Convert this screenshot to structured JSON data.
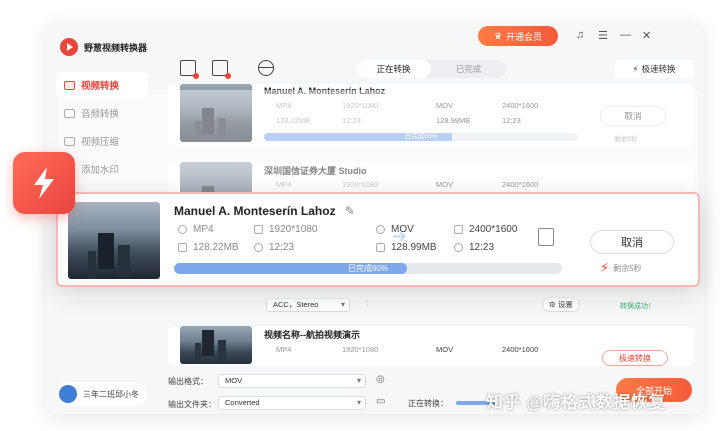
{
  "app": {
    "title": "野葱视频转换器"
  },
  "header": {
    "vip_label": "开通会员"
  },
  "sidebar": {
    "items": [
      {
        "label": "视频转换"
      },
      {
        "label": "音频转换"
      },
      {
        "label": "视频压缩"
      },
      {
        "label": "添加水印"
      }
    ],
    "user_name": "三年二班邱小冬"
  },
  "tabs": {
    "converting": "正在转换",
    "done": "已完成"
  },
  "turbo_label": "极速转换",
  "cards": [
    {
      "title": "Manuel A. Monteserín Lahoz",
      "src_format": "MP4",
      "src_resolution": "1920*1080",
      "src_size": "128.22MB",
      "src_duration": "12:23",
      "dst_format": "MOV",
      "dst_resolution": "2400*1600",
      "dst_size": "128.99MB",
      "dst_duration": "12:23",
      "progress_label": "已完成60%",
      "progress": 0.6,
      "cancel_label": "取消",
      "remaining": "剩余5秒"
    },
    {
      "title": "深圳国信证券大厦  Studio",
      "src_format": "MP4",
      "src_resolution": "1920*1080",
      "dst_format": "MOV",
      "dst_resolution": "2400*1600"
    },
    {
      "title": "视频名称--航拍视频演示",
      "src_format": "MP4",
      "src_resolution": "1920*1080",
      "dst_format": "MOV",
      "dst_resolution": "2400*1600",
      "turbo_label": "极速转换"
    }
  ],
  "hidden_row": {
    "audio_select": "ACC，Stereo",
    "settings_label": "设置",
    "status": "转换成功！"
  },
  "callout": {
    "title": "Manuel A. Monteserín Lahoz",
    "src_format": "MP4",
    "src_resolution": "1920*1080",
    "src_size": "128.22MB",
    "src_duration": "12:23",
    "dst_format": "MOV",
    "dst_resolution": "2400*1600",
    "dst_size": "128.99MB",
    "dst_duration": "12:23",
    "progress_label": "已完成60%",
    "progress": 0.6,
    "cancel_label": "取消",
    "remaining": "剩余5秒"
  },
  "footer": {
    "output_format_label": "输出格式：",
    "output_format_value": "MOV",
    "output_folder_label": "输出文件夹：",
    "output_folder_value": "Converted",
    "converting_label": "正在转换：",
    "start_all_label": "全部开始"
  },
  "watermark": "知乎 @嗨格式数据恢复",
  "colors": {
    "accent": "#e8453c",
    "progress": "#7ea8ea"
  }
}
